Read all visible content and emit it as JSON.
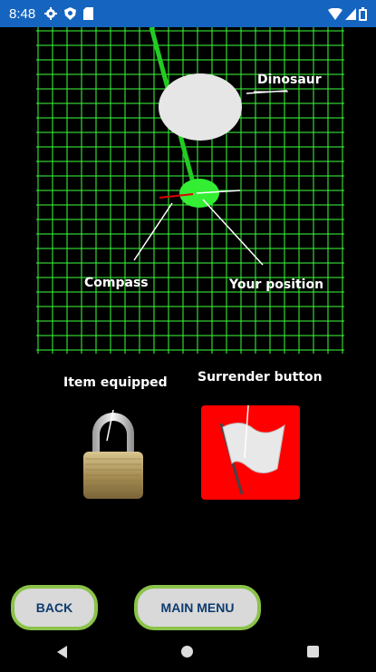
{
  "status_bar": {
    "time": "8:48",
    "icons_left": [
      "gear-icon",
      "shield-icon",
      "sd-card-icon"
    ],
    "icons_right": [
      "wifi-icon",
      "signal-icon",
      "battery-icon"
    ]
  },
  "game": {
    "grid_color": "#3cff3c",
    "annotations": {
      "dinosaur": "Dinosaur",
      "compass": "Compass",
      "your_position": "Your position",
      "item_equipped": "Item equipped",
      "surrender_button": "Surrender button"
    },
    "item_icon": "padlock-icon",
    "surrender_icon": "white-flag-icon",
    "surrender_color": "#ff0000"
  },
  "buttons": {
    "back": "BACK",
    "main_menu": "MAIN MENU"
  },
  "nav": [
    "back-nav-icon",
    "home-nav-icon",
    "recents-nav-icon"
  ],
  "colors": {
    "status_bar": "#1565c0",
    "button_border": "#8bc34a",
    "button_fill": "#d9d9d9",
    "button_text": "#0d3b6e",
    "player": "#33ee33",
    "dinosaur": "#e6e6e6"
  }
}
